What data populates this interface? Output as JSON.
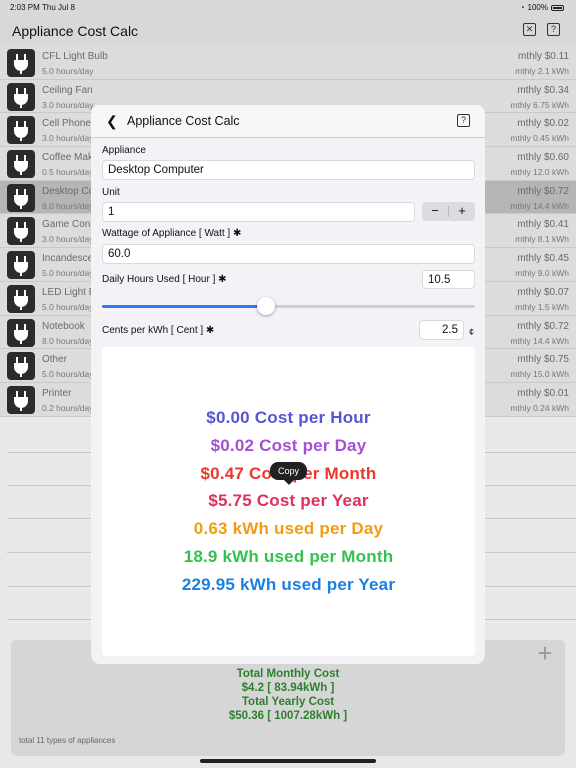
{
  "status_bar": {
    "time": "2:03 PM",
    "date": "Thu Jul 8",
    "battery": "100%"
  },
  "background": {
    "title": "Appliance Cost Calc",
    "close_icon": "x-box-icon",
    "help_icon": "?"
  },
  "list": [
    {
      "name": "CFL Light Bulb",
      "hours": "5.0 hours/day",
      "cost": "mthly $0.11",
      "kwh": "mthly 2.1 kWh"
    },
    {
      "name": "Ceiling Fan",
      "hours": "3.0 hours/day",
      "cost": "mthly $0.34",
      "kwh": "mthly 6.75 kWh"
    },
    {
      "name": "Cell Phone",
      "hours": "3.0 hours/day",
      "cost": "mthly $0.02",
      "kwh": "mthly 0.45 kWh"
    },
    {
      "name": "Coffee Mak",
      "hours": "0.5 hours/day",
      "cost": "mthly $0.60",
      "kwh": "mthly 12.0 kWh"
    },
    {
      "name": "Desktop Co",
      "hours": "8.0 hours/day",
      "cost": "mthly $0.72",
      "kwh": "mthly 14.4 kWh"
    },
    {
      "name": "Game Cons",
      "hours": "3.0 hours/day",
      "cost": "mthly $0.41",
      "kwh": "mthly 8.1 kWh"
    },
    {
      "name": "Incandesce",
      "hours": "5.0 hours/day",
      "cost": "mthly $0.45",
      "kwh": "mthly 9.0 kWh"
    },
    {
      "name": "LED Light B",
      "hours": "5.0 hours/day",
      "cost": "mthly $0.07",
      "kwh": "mthly 1.5 kWh"
    },
    {
      "name": "Notebook",
      "hours": "8.0 hours/day",
      "cost": "mthly $0.72",
      "kwh": "mthly 14.4 kWh"
    },
    {
      "name": "Other",
      "hours": "5.0 hours/day",
      "cost": "mthly $0.75",
      "kwh": "mthly 15.0 kWh"
    },
    {
      "name": "Printer",
      "hours": "0.2 hours/day",
      "cost": "mthly $0.01",
      "kwh": "mthly 0.24 kWh"
    }
  ],
  "footer": {
    "total_monthly_label": "Total Monthly Cost",
    "total_monthly_value": "$4.2 [ 83.94kWh ]",
    "total_yearly_label": "Total Yearly Cost",
    "total_yearly_value": "$50.36 [ 1007.28kWh ]",
    "count_note": "total 11 types of appliances",
    "add_icon": "+"
  },
  "modal": {
    "back_icon": "chevron-left-icon",
    "title": "Appliance Cost Calc",
    "help_icon": "?",
    "appliance_label": "Appliance",
    "appliance_value": "Desktop Computer",
    "unit_label": "Unit",
    "unit_value": "1",
    "stepper_minus": "−",
    "stepper_plus": "+",
    "wattage_label": "Wattage of Appliance [ Watt ] ✱",
    "wattage_value": "60.0",
    "hours_label": "Daily Hours Used [ Hour ] ✱",
    "hours_value": "10.5",
    "hours_slider_level": 0.44,
    "cents_label": "Cents per kWh [ Cent ] ✱",
    "cents_value": "2.5",
    "cents_unit": "¢",
    "copy_tooltip": "Copy",
    "results": [
      {
        "text": "$0.00 Cost per Hour",
        "color": "#5755cf"
      },
      {
        "text": "$0.02 Cost per Day",
        "color": "#a550d6"
      },
      {
        "text": "$0.47 Cost per Month",
        "color": "#e8392f"
      },
      {
        "text": "$5.75 Cost per Year",
        "color": "#e0305a"
      },
      {
        "text": "0.63 kWh used per Day",
        "color": "#f39c12"
      },
      {
        "text": "18.9 kWh used per Month",
        "color": "#33c24d"
      },
      {
        "text": "229.95 kWh used per Year",
        "color": "#1a7fe6"
      }
    ]
  }
}
